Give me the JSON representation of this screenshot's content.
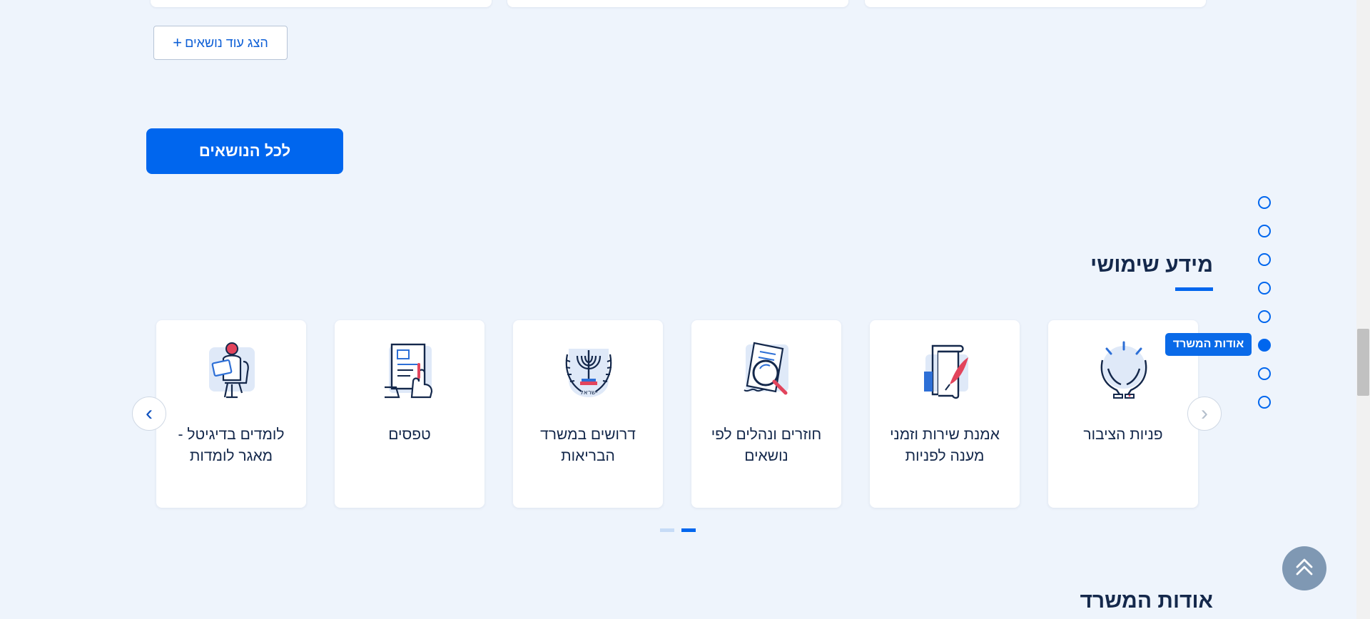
{
  "more_topics": {
    "label": "הצג עוד נושאים",
    "plus": "+"
  },
  "all_topics_button": "לכל הנושאים",
  "useful_info": {
    "title": "מידע שימושי",
    "cards": [
      {
        "label": "פניות הציבור",
        "icon": "hands-icon"
      },
      {
        "label": "אמנת שירות וזמני מענה לפניות",
        "icon": "scroll-feather-icon"
      },
      {
        "label": "חוזרים ונהלים לפי נושאים",
        "icon": "magnifier-document-icon"
      },
      {
        "label": "דרושים במשרד הבריאות",
        "icon": "israel-emblem-icon",
        "emblem_text": "ישראל"
      },
      {
        "label": "טפסים",
        "icon": "form-hand-icon"
      },
      {
        "label": "לומדים בדיגיטל - מאגר לומדות",
        "icon": "person-tablet-icon"
      }
    ],
    "prev_arrow": "‹",
    "next_arrow": "›",
    "pagination": {
      "pages": 2,
      "active": 2
    }
  },
  "side_nav": {
    "count": 8,
    "active_index": 5,
    "tooltip": "אודות המשרד"
  },
  "about_title": "אודות המשרד",
  "colors": {
    "primary": "#0066ee",
    "background": "#eef4fc",
    "text": "#14284b",
    "accent_red": "#e2445c"
  }
}
